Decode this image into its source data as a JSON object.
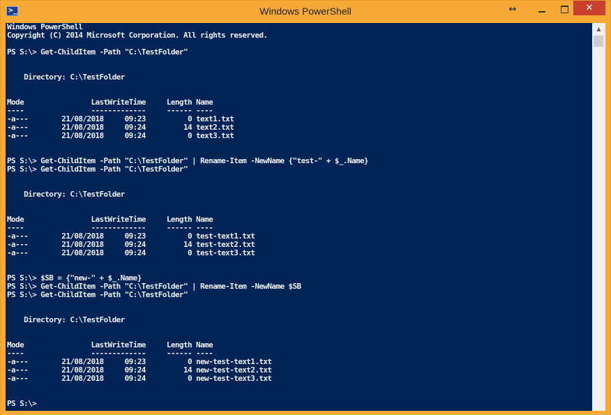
{
  "window": {
    "title": "Windows PowerShell",
    "icon": "powershell-icon",
    "icon_glyph": ">_",
    "controls": {
      "resize_glyph": "↔",
      "close_glyph": "✕"
    },
    "accent_color": "#f6a935",
    "console_bg": "#012456",
    "console_fg": "#eeedf0"
  },
  "console": {
    "lines": [
      "Windows PowerShell",
      "Copyright (C) 2014 Microsoft Corporation. All rights reserved.",
      "",
      "PS S:\\> Get-ChildItem -Path \"C:\\TestFolder\"",
      "",
      "",
      "    Directory: C:\\TestFolder",
      "",
      "",
      "Mode                LastWriteTime     Length Name",
      "----                -------------     ------ ----",
      "-a---        21/08/2018     09:23          0 text1.txt",
      "-a---        21/08/2018     09:24         14 text2.txt",
      "-a---        21/08/2018     09:24          0 text3.txt",
      "",
      "",
      "PS S:\\> Get-ChildItem -Path \"C:\\TestFolder\" | Rename-Item -NewName {\"test-\" + $_.Name}",
      "PS S:\\> Get-ChildItem -Path \"C:\\TestFolder\"",
      "",
      "",
      "    Directory: C:\\TestFolder",
      "",
      "",
      "Mode                LastWriteTime     Length Name",
      "----                -------------     ------ ----",
      "-a---        21/08/2018     09:23          0 test-text1.txt",
      "-a---        21/08/2018     09:24         14 test-text2.txt",
      "-a---        21/08/2018     09:24          0 test-text3.txt",
      "",
      "",
      "PS S:\\> $SB = {\"new-\" + $_.Name}",
      "PS S:\\> Get-ChildItem -Path \"C:\\TestFolder\" | Rename-Item -NewName $SB",
      "PS S:\\> Get-ChildItem -Path \"C:\\TestFolder\"",
      "",
      "",
      "    Directory: C:\\TestFolder",
      "",
      "",
      "Mode                LastWriteTime     Length Name",
      "----                -------------     ------ ----",
      "-a---        21/08/2018     09:23          0 new-test-text1.txt",
      "-a---        21/08/2018     09:24         14 new-test-text2.txt",
      "-a---        21/08/2018     09:24          0 new-test-text3.txt",
      "",
      "",
      "PS S:\\>"
    ]
  }
}
